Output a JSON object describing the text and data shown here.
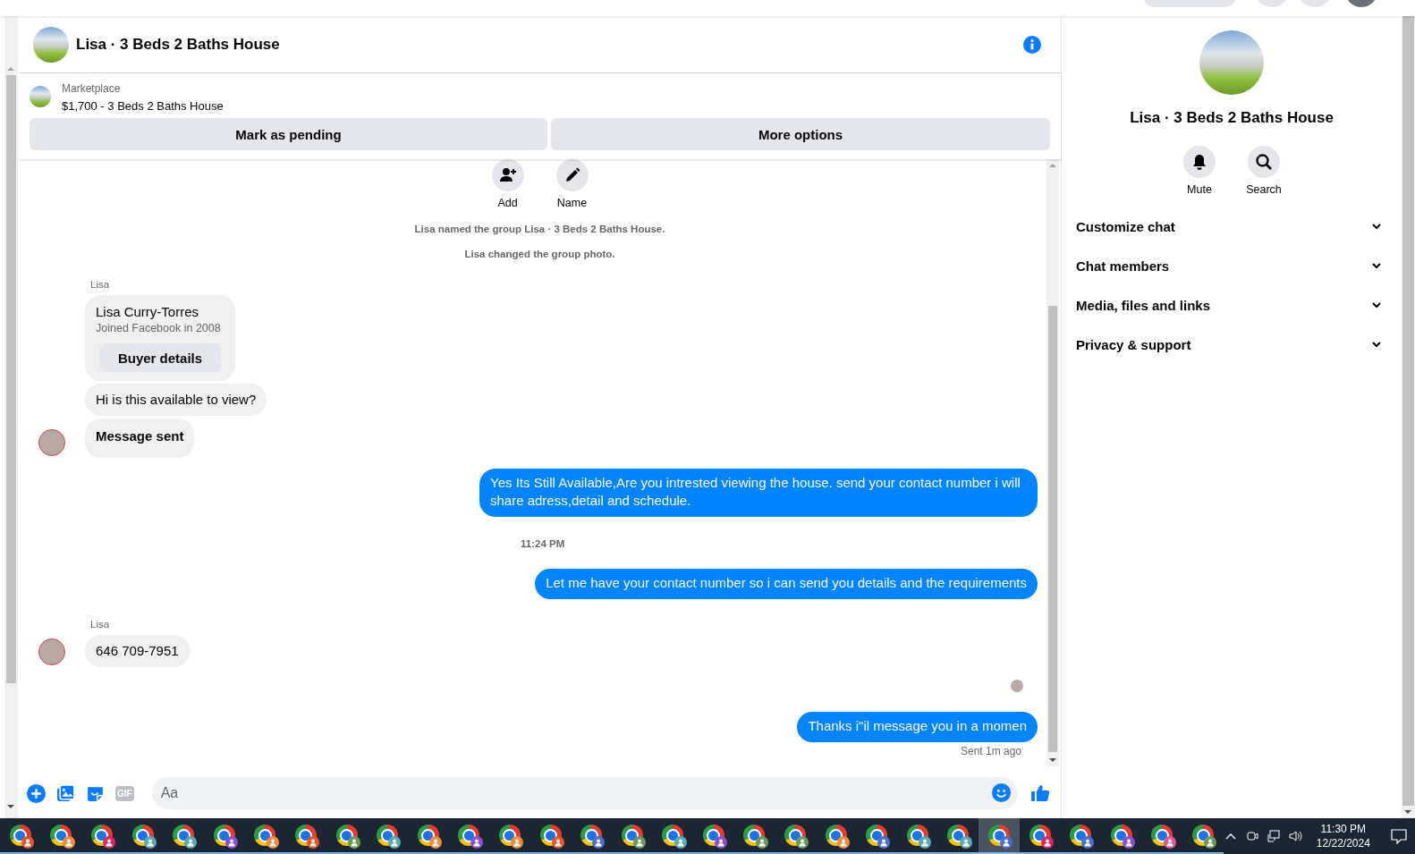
{
  "conversation": {
    "title": "Lisa · 3 Beds 2 Baths House"
  },
  "listing": {
    "source": "Marketplace",
    "title": "$1,700 - 3 Beds 2 Baths House",
    "actions": [
      "Mark as pending",
      "More options"
    ]
  },
  "group_actions": [
    {
      "label": "Add",
      "kind": "add"
    },
    {
      "label": "Name",
      "kind": "name"
    }
  ],
  "messages": [
    {
      "kind": "system",
      "text": "Lisa named the group Lisa · 3 Beds 2 Baths House."
    },
    {
      "kind": "system",
      "text": "Lisa changed the group photo."
    },
    {
      "kind": "sender",
      "text": "Lisa"
    },
    {
      "kind": "profile_card",
      "name": "Lisa Curry-Torres",
      "detail": "Joined Facebook in 2008",
      "action": "Buyer details"
    },
    {
      "kind": "incoming",
      "text": "Hi is this available to view?",
      "avatar": false,
      "bold": false
    },
    {
      "kind": "incoming",
      "text": "Message sent",
      "avatar": true,
      "bold": true
    },
    {
      "kind": "outgoing",
      "text": "Yes Its Still Available,Are you intrested viewing the house. send your contact number i will share adress,detail and schedule."
    },
    {
      "kind": "time",
      "text": "11:24 PM"
    },
    {
      "kind": "outgoing",
      "text": "Let me have your contact number so i can send you details and the requirements"
    },
    {
      "kind": "sender",
      "text": "Lisa"
    },
    {
      "kind": "incoming",
      "text": "646 709-7951",
      "avatar": true,
      "bold": false
    },
    {
      "kind": "seen"
    },
    {
      "kind": "outgoing",
      "text": "Thanks i\"il message you in a momen"
    },
    {
      "kind": "status",
      "text": "Sent 1m ago"
    }
  ],
  "composer": {
    "gif_label": "GIF",
    "placeholder": "Aa"
  },
  "details": {
    "title": "Lisa · 3 Beds 2 Baths House",
    "actions": [
      {
        "label": "Mute",
        "kind": "mute"
      },
      {
        "label": "Search",
        "kind": "search"
      }
    ],
    "sections": [
      {
        "label": "Customize chat",
        "expanded": false
      },
      {
        "label": "Chat members",
        "expanded": false
      },
      {
        "label": "Media, files and links",
        "expanded": false
      },
      {
        "label": "Privacy & support",
        "expanded": false
      }
    ]
  },
  "taskbar": {
    "apps": [
      {
        "color": "#e8542a",
        "selected": false
      },
      {
        "color": "#f08a3c",
        "selected": false
      },
      {
        "color": "#e0245e",
        "selected": false
      },
      {
        "color": "#5aa9b0",
        "selected": false
      },
      {
        "color": "#5aa9b0",
        "selected": false
      },
      {
        "color": "#8a4fcf",
        "selected": false
      },
      {
        "color": "#f08a3c",
        "selected": false
      },
      {
        "color": "#e8542a",
        "selected": false
      },
      {
        "color": "#6a9a5b",
        "selected": false
      },
      {
        "color": "#5aa9b0",
        "selected": false
      },
      {
        "color": "#f08a3c",
        "selected": false
      },
      {
        "color": "#8a4fcf",
        "selected": false
      },
      {
        "color": "#f08a3c",
        "selected": false
      },
      {
        "color": "#e8542a",
        "selected": false
      },
      {
        "color": "#4a6fcf",
        "selected": false
      },
      {
        "color": "#6a9a5b",
        "selected": false
      },
      {
        "color": "#5aa9b0",
        "selected": false
      },
      {
        "color": "#8a4fcf",
        "selected": false
      },
      {
        "color": "#6a9a5b",
        "selected": false
      },
      {
        "color": "#6a9a5b",
        "selected": false
      },
      {
        "color": "#f08a3c",
        "selected": false
      },
      {
        "color": "#4a6fcf",
        "selected": false
      },
      {
        "color": "#5aa9b0",
        "selected": false
      },
      {
        "color": "#5aa9b0",
        "selected": false
      },
      {
        "color": "#4a6fcf",
        "selected": true
      },
      {
        "color": "#e0245e",
        "selected": false
      },
      {
        "color": "#4a6fcf",
        "selected": false
      },
      {
        "color": "#8a4fcf",
        "selected": false
      },
      {
        "color": "#e0579a",
        "selected": false
      },
      {
        "color": "#6a9a5b",
        "selected": false
      }
    ],
    "clock": {
      "time": "11:30 PM",
      "date": "12/22/2024"
    }
  }
}
